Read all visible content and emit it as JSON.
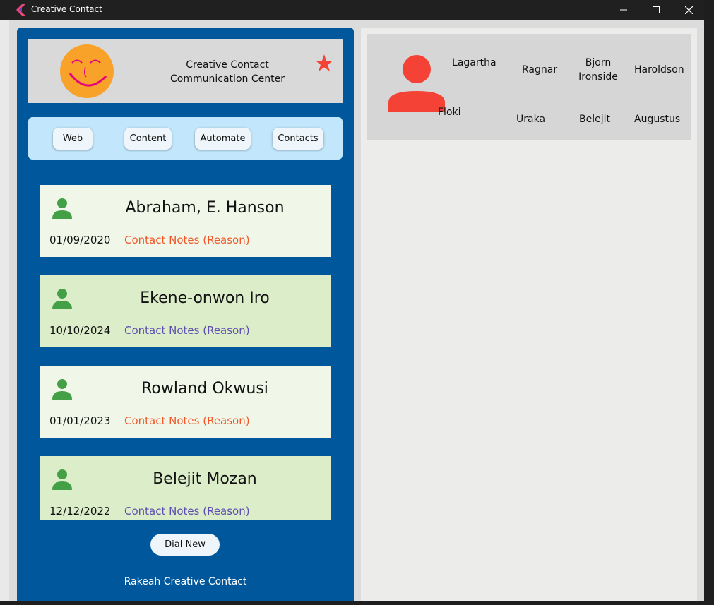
{
  "window": {
    "title": "Creative Contact",
    "controls": {
      "minimize": "—",
      "maximize": "☐",
      "close": "✕"
    }
  },
  "header": {
    "title_line1": "Creative Contact",
    "title_line2": "Communication Center",
    "logo_icon": "smiley-icon",
    "favorite_icon": "star-icon"
  },
  "nav": {
    "web": "Web",
    "content": "Content",
    "automate": "Automate",
    "contacts": "Contacts"
  },
  "contacts": [
    {
      "name": "Abraham, E. Hanson",
      "date": "01/09/2020",
      "notes": "Contact Notes (Reason)",
      "notes_color": "#f0582a",
      "bg": "#f0f7e8"
    },
    {
      "name": "Ekene-onwon Iro",
      "date": "10/10/2024",
      "notes": "Contact Notes (Reason)",
      "notes_color": "#5e4fb0",
      "bg": "#dcedc9"
    },
    {
      "name": "Rowland Okwusi",
      "date": "01/01/2023",
      "notes": "Contact Notes (Reason)",
      "notes_color": "#f0582a",
      "bg": "#f0f7e8"
    },
    {
      "name": "Belejit Mozan",
      "date": "12/12/2022",
      "notes": "Contact Notes (Reason)",
      "notes_color": "#5e4fb0",
      "bg": "#dcedc9"
    }
  ],
  "actions": {
    "dial_new": "Dial New"
  },
  "footer": {
    "text": "Rakeah Creative Contact"
  },
  "profile": {
    "avatar_icon": "person-icon",
    "names": {
      "lagartha": "Lagartha",
      "ragnar": "Ragnar",
      "bjorn_line1": "Bjorn",
      "bjorn_line2": "Ironside",
      "haroldson": "Haroldson",
      "floki": "Floki",
      "uraka": "Uraka",
      "belejit": "Belejit",
      "augustus": "Augustus"
    }
  },
  "colors": {
    "panel_blue": "#01579b",
    "person_green": "#43a047",
    "avatar_red": "#f44336",
    "smiley_orange": "#f9a22a",
    "smiley_pink": "#e6007e"
  }
}
